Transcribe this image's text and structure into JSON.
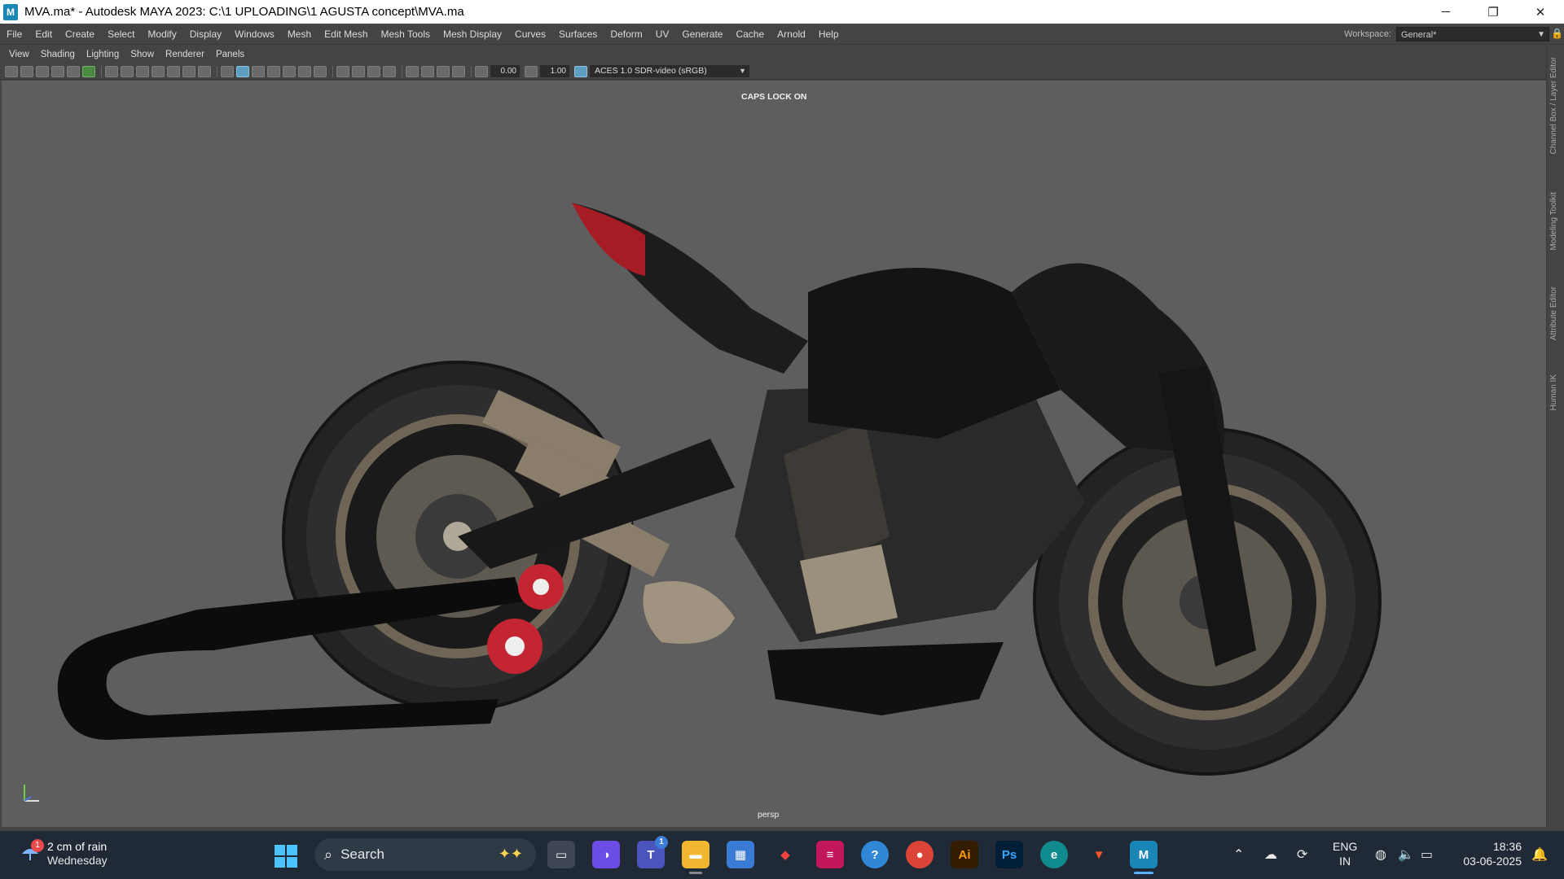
{
  "window": {
    "title": "MVA.ma* - Autodesk MAYA 2023: C:\\1 UPLOADING\\1 AGUSTA concept\\MVA.ma",
    "app_icon_label": "M",
    "minimize": "─",
    "restore": "❐",
    "close": "✕"
  },
  "menubar": {
    "items": [
      "File",
      "Edit",
      "Create",
      "Select",
      "Modify",
      "Display",
      "Windows",
      "Mesh",
      "Edit Mesh",
      "Mesh Tools",
      "Mesh Display",
      "Curves",
      "Surfaces",
      "Deform",
      "UV",
      "Generate",
      "Cache",
      "Arnold",
      "Help"
    ],
    "workspace_label": "Workspace:",
    "workspace_value": "General*"
  },
  "panel_menu": {
    "items": [
      "View",
      "Shading",
      "Lighting",
      "Show",
      "Renderer",
      "Panels"
    ]
  },
  "toolbar": {
    "field_1": "0.00",
    "field_2": "1.00",
    "colorspace": "ACES 1.0 SDR-video (sRGB)"
  },
  "viewport": {
    "hud_message": "CAPS LOCK ON",
    "camera_label": "persp",
    "background_color": "#5e5e5e"
  },
  "right_dock": {
    "tabs": [
      "Channel Box / Layer Editor",
      "Modeling Toolkit",
      "Attribute Editor",
      "Human IK"
    ]
  },
  "taskbar": {
    "weather_badge": "1",
    "weather_line1": "2 cm of rain",
    "weather_line2": "Wednesday",
    "search_placeholder": "Search",
    "teams_badge": "1",
    "illustrator_label": "Ai",
    "photoshop_label": "Ps",
    "maya_label": "M",
    "lang_line1": "ENG",
    "lang_line2": "IN",
    "time": "18:36",
    "date": "03-06-2025"
  },
  "colors": {
    "accent_blue": "#5ab0ff",
    "maya_brand": "#1a86b8",
    "taskbar_bg": "#1f2a36"
  }
}
